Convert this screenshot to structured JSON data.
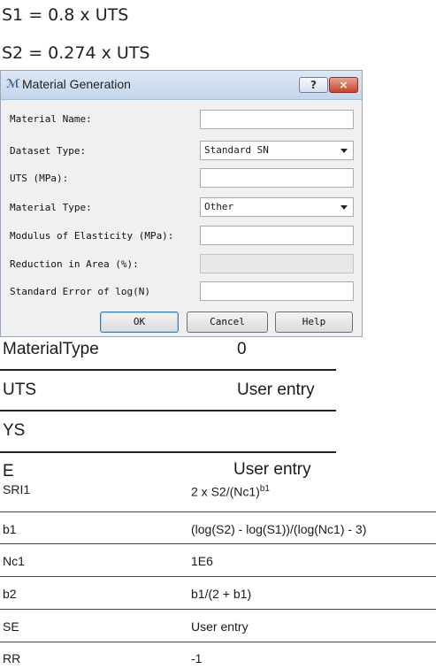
{
  "formulas": {
    "s1": "S1 = 0.8 x UTS",
    "s2": "S2 = 0.274 x UTS"
  },
  "dialog": {
    "title": "Material Generation",
    "title_icon": "material-icon",
    "help_label": "?",
    "close_label": "×",
    "fields": [
      {
        "label": "Material Name:",
        "value": ""
      },
      {
        "label": "Dataset Type:",
        "value": "Standard SN"
      },
      {
        "label": "UTS (MPa):",
        "value": ""
      },
      {
        "label": "Material Type:",
        "value": "Other"
      },
      {
        "label": "Modulus of Elasticity (MPa):",
        "value": ""
      },
      {
        "label": "Reduction in Area (%):",
        "value": ""
      },
      {
        "label": "Standard Error of log(N)",
        "value": ""
      }
    ],
    "buttons": {
      "ok": "OK",
      "cancel": "Cancel",
      "help": "Help"
    }
  },
  "table1": [
    {
      "label": "MaterialType",
      "value": "0"
    },
    {
      "label": "UTS",
      "value": "User entry"
    },
    {
      "label": "YS",
      "value": ""
    },
    {
      "label": "E",
      "value": "User entry"
    }
  ],
  "table2": [
    {
      "label": "SRI1",
      "value_main": "2 x S2/(Nc1)",
      "value_sup": "b1"
    },
    {
      "label": "b1",
      "value": "(log(S2) - log(S1))/(log(Nc1) - 3)"
    },
    {
      "label": "Nc1",
      "value": "1E6"
    },
    {
      "label": "b2",
      "value": "b1/(2 + b1)"
    },
    {
      "label": "SE",
      "value": "User entry"
    },
    {
      "label": "RR",
      "value": "-1"
    }
  ]
}
